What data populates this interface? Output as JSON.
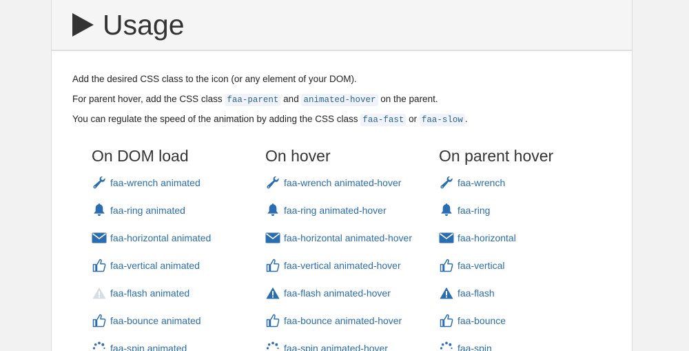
{
  "heading": {
    "title": "Usage"
  },
  "intro": {
    "line1": "Add the desired CSS class to the icon (or any element of your DOM).",
    "line2_pre": "For parent hover, add the CSS class",
    "line2_code1": "faa-parent",
    "line2_mid": "and",
    "line2_code2": "animated-hover",
    "line2_post": "on the parent.",
    "line3_pre": "You can regulate the speed of the animation by adding the CSS class",
    "line3_code1": "faa-fast",
    "line3_mid": "or",
    "line3_code2": "faa-slow",
    "line3_post": "."
  },
  "columns": [
    {
      "title": "On DOM load",
      "items": [
        {
          "icon": "wrench-icon",
          "label": "faa-wrench animated"
        },
        {
          "icon": "bell-icon",
          "label": "faa-ring animated"
        },
        {
          "icon": "envelope-icon",
          "label": "faa-horizontal animated"
        },
        {
          "icon": "thumbs-up-icon",
          "label": "faa-vertical animated"
        },
        {
          "icon": "warning-icon",
          "label": "faa-flash animated"
        },
        {
          "icon": "thumbs-up-icon",
          "label": "faa-bounce animated"
        },
        {
          "icon": "spinner-icon",
          "label": "faa-spin animated"
        }
      ]
    },
    {
      "title": "On hover",
      "items": [
        {
          "icon": "wrench-icon",
          "label": "faa-wrench animated-hover"
        },
        {
          "icon": "bell-icon",
          "label": "faa-ring animated-hover"
        },
        {
          "icon": "envelope-icon",
          "label": "faa-horizontal animated-hover"
        },
        {
          "icon": "thumbs-up-icon",
          "label": "faa-vertical animated-hover"
        },
        {
          "icon": "warning-icon",
          "label": "faa-flash animated-hover"
        },
        {
          "icon": "thumbs-up-icon",
          "label": "faa-bounce animated-hover"
        },
        {
          "icon": "spinner-icon",
          "label": "faa-spin animated-hover"
        }
      ]
    },
    {
      "title": "On parent hover",
      "items": [
        {
          "icon": "wrench-icon",
          "label": "faa-wrench"
        },
        {
          "icon": "bell-icon",
          "label": "faa-ring"
        },
        {
          "icon": "envelope-icon",
          "label": "faa-horizontal"
        },
        {
          "icon": "thumbs-up-icon",
          "label": "faa-vertical"
        },
        {
          "icon": "warning-icon",
          "label": "faa-flash"
        },
        {
          "icon": "thumbs-up-icon",
          "label": "faa-bounce"
        },
        {
          "icon": "spinner-icon",
          "label": "faa-spin"
        }
      ]
    }
  ],
  "colors": {
    "link": "#2a6db0",
    "icon": "#2a6db0",
    "flash_faded": "#d6dde6"
  }
}
